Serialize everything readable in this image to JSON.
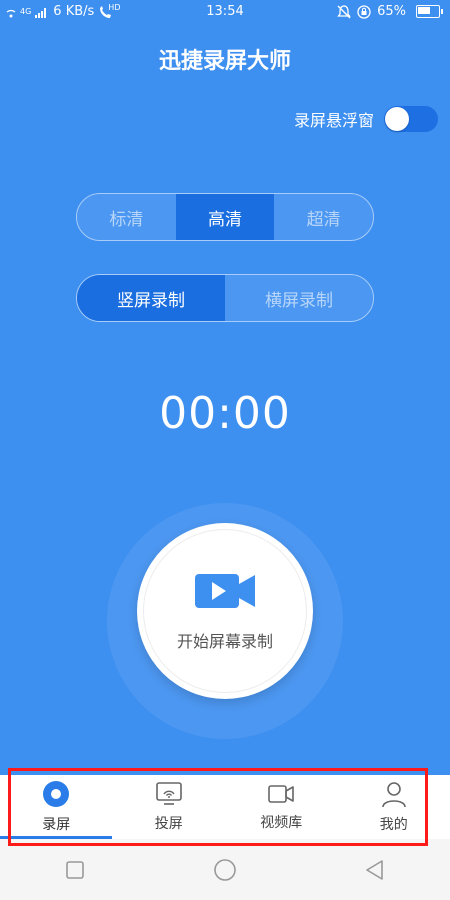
{
  "status_bar": {
    "network": "4G",
    "speed": "6 KB/s",
    "hd": "HD",
    "time": "13:54",
    "battery": "65%",
    "battery_level": 0.65
  },
  "app": {
    "title": "迅捷录屏大师"
  },
  "floating_window": {
    "label": "录屏悬浮窗",
    "enabled": true
  },
  "quality": {
    "options": [
      "标清",
      "高清",
      "超清"
    ],
    "selected": "高清"
  },
  "orientation": {
    "options": [
      "竖屏录制",
      "横屏录制"
    ],
    "selected": "竖屏录制"
  },
  "timer": "00:00",
  "record_button": {
    "label": "开始屏幕录制"
  },
  "bottom_nav": {
    "items": [
      {
        "label": "录屏",
        "icon": "record-icon",
        "active": true
      },
      {
        "label": "投屏",
        "icon": "cast-icon",
        "active": false
      },
      {
        "label": "视频库",
        "icon": "video-library-icon",
        "active": false
      },
      {
        "label": "我的",
        "icon": "profile-icon",
        "active": false
      }
    ]
  },
  "colors": {
    "primary": "#3d8ff0",
    "accent": "#1b6ee0",
    "highlight": "#ff1a1a"
  }
}
